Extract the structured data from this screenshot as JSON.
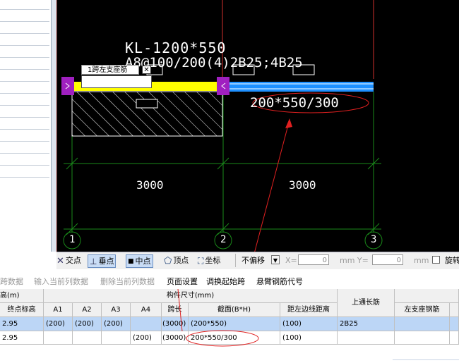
{
  "cad": {
    "beam_label_line1": "KL-1200*550",
    "beam_label_line2": "A8@100/200(4)2B25;4B25",
    "section_label": "200*550/300",
    "span_dim_1": "3000",
    "span_dim_2": "3000",
    "axis_1": "1",
    "axis_2": "2",
    "axis_3": "3",
    "input_popup_title": "1跨左支座筋",
    "input_popup_value": ""
  },
  "snap_toolbar": {
    "intersection": "交点",
    "perpendicular": "垂点",
    "midpoint": "中点",
    "vertex": "顶点",
    "coordinate": "坐标",
    "offset_select": "不偏移",
    "x_label": "X=",
    "x_value": "0",
    "y_label": "mm Y=",
    "y_value": "0",
    "unit_mm": "mm",
    "rotate_label": "旋转"
  },
  "action_toolbar": {
    "copy_span": "跨数据",
    "input_current": "输入当前列数据",
    "delete_current": "删除当前列数据",
    "page_setup": "页面设置",
    "swap_start": "调换起始跨",
    "cantilever_code": "悬臂钢筋代号"
  },
  "table": {
    "group_left": "高(m)",
    "group_dims": "构件尺寸(mm)",
    "h_end_elev": "终点标高",
    "h_a1": "A1",
    "h_a2": "A2",
    "h_a3": "A3",
    "h_a4": "A4",
    "h_span": "跨长",
    "h_section": "截面(B*H)",
    "h_left_edge": "距左边线距离",
    "h_top_through": "上通长筋",
    "h_left_support": "左支座钢筋",
    "rows": [
      {
        "end_elev": "2.95",
        "a1": "(200)",
        "a2": "(200)",
        "a3": "(200)",
        "a4": "",
        "span": "(3000)",
        "section": "(200*550)",
        "left_edge": "(100)",
        "top_through": "2B25",
        "left_support": ""
      },
      {
        "end_elev": "2.95",
        "a1": "",
        "a2": "",
        "a3": "",
        "a4": "(200)",
        "span": "(3000)",
        "section": "200*550/300",
        "left_edge": "(100)",
        "top_through": "",
        "left_support": ""
      }
    ]
  }
}
